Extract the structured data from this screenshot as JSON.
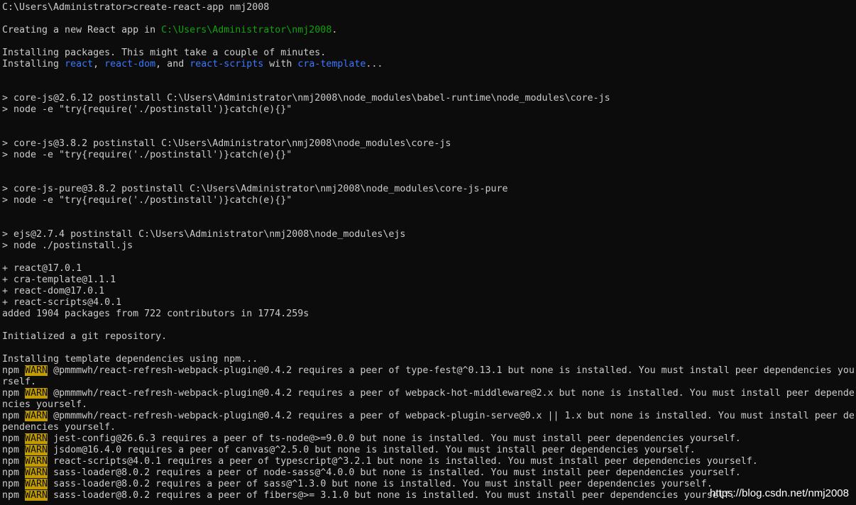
{
  "colors": {
    "background": "#0c0c0c",
    "text": "#cccccc",
    "green": "#13a10e",
    "blue": "#3b78ff",
    "warn_bg": "#c19c00"
  },
  "lines": [
    [
      {
        "t": "C:\\Users\\Administrator>create-react-app nmj2008"
      }
    ],
    [],
    [
      {
        "t": "Creating a new React app in "
      },
      {
        "t": "C:\\Users\\Administrator\\nmj2008",
        "c": "green"
      },
      {
        "t": "."
      }
    ],
    [],
    [
      {
        "t": "Installing packages. This might take a couple of minutes."
      }
    ],
    [
      {
        "t": "Installing "
      },
      {
        "t": "react",
        "c": "blue"
      },
      {
        "t": ", "
      },
      {
        "t": "react-dom",
        "c": "blue"
      },
      {
        "t": ", and "
      },
      {
        "t": "react-scripts",
        "c": "blue"
      },
      {
        "t": " with "
      },
      {
        "t": "cra-template",
        "c": "blue"
      },
      {
        "t": "..."
      }
    ],
    [],
    [],
    [
      {
        "t": "> core-js@2.6.12 postinstall C:\\Users\\Administrator\\nmj2008\\node_modules\\babel-runtime\\node_modules\\core-js"
      }
    ],
    [
      {
        "t": "> node -e \"try{require('./postinstall')}catch(e){}\""
      }
    ],
    [],
    [],
    [
      {
        "t": "> core-js@3.8.2 postinstall C:\\Users\\Administrator\\nmj2008\\node_modules\\core-js"
      }
    ],
    [
      {
        "t": "> node -e \"try{require('./postinstall')}catch(e){}\""
      }
    ],
    [],
    [],
    [
      {
        "t": "> core-js-pure@3.8.2 postinstall C:\\Users\\Administrator\\nmj2008\\node_modules\\core-js-pure"
      }
    ],
    [
      {
        "t": "> node -e \"try{require('./postinstall')}catch(e){}\""
      }
    ],
    [],
    [],
    [
      {
        "t": "> ejs@2.7.4 postinstall C:\\Users\\Administrator\\nmj2008\\node_modules\\ejs"
      }
    ],
    [
      {
        "t": "> node ./postinstall.js"
      }
    ],
    [],
    [
      {
        "t": "+ react@17.0.1"
      }
    ],
    [
      {
        "t": "+ cra-template@1.1.1"
      }
    ],
    [
      {
        "t": "+ react-dom@17.0.1"
      }
    ],
    [
      {
        "t": "+ react-scripts@4.0.1"
      }
    ],
    [
      {
        "t": "added 1904 packages from 722 contributors in 1774.259s"
      }
    ],
    [],
    [
      {
        "t": "Initialized a git repository."
      }
    ],
    [],
    [
      {
        "t": "Installing template dependencies using npm..."
      }
    ],
    [
      {
        "t": "npm "
      },
      {
        "t": "WARN",
        "c": "warn"
      },
      {
        "t": " @pmmmwh/react-refresh-webpack-plugin@0.4.2 requires a peer of type-fest@^0.13.1 but none is installed. You must install peer dependencies you"
      }
    ],
    [
      {
        "t": "rself."
      }
    ],
    [
      {
        "t": "npm "
      },
      {
        "t": "WARN",
        "c": "warn"
      },
      {
        "t": " @pmmmwh/react-refresh-webpack-plugin@0.4.2 requires a peer of webpack-hot-middleware@2.x but none is installed. You must install peer depende"
      }
    ],
    [
      {
        "t": "ncies yourself."
      }
    ],
    [
      {
        "t": "npm "
      },
      {
        "t": "WARN",
        "c": "warn"
      },
      {
        "t": " @pmmmwh/react-refresh-webpack-plugin@0.4.2 requires a peer of webpack-plugin-serve@0.x || 1.x but none is installed. You must install peer de"
      }
    ],
    [
      {
        "t": "pendencies yourself."
      }
    ],
    [
      {
        "t": "npm "
      },
      {
        "t": "WARN",
        "c": "warn"
      },
      {
        "t": " jest-config@26.6.3 requires a peer of ts-node@>=9.0.0 but none is installed. You must install peer dependencies yourself."
      }
    ],
    [
      {
        "t": "npm "
      },
      {
        "t": "WARN",
        "c": "warn"
      },
      {
        "t": " jsdom@16.4.0 requires a peer of canvas@^2.5.0 but none is installed. You must install peer dependencies yourself."
      }
    ],
    [
      {
        "t": "npm "
      },
      {
        "t": "WARN",
        "c": "warn"
      },
      {
        "t": " react-scripts@4.0.1 requires a peer of typescript@^3.2.1 but none is installed. You must install peer dependencies yourself."
      }
    ],
    [
      {
        "t": "npm "
      },
      {
        "t": "WARN",
        "c": "warn"
      },
      {
        "t": " sass-loader@8.0.2 requires a peer of node-sass@^4.0.0 but none is installed. You must install peer dependencies yourself."
      }
    ],
    [
      {
        "t": "npm "
      },
      {
        "t": "WARN",
        "c": "warn"
      },
      {
        "t": " sass-loader@8.0.2 requires a peer of sass@^1.3.0 but none is installed. You must install peer dependencies yourself."
      }
    ],
    [
      {
        "t": "npm "
      },
      {
        "t": "WARN",
        "c": "warn"
      },
      {
        "t": " sass-loader@8.0.2 requires a peer of fibers@>= 3.1.0 but none is installed. You must install peer dependencies yourself."
      }
    ]
  ],
  "watermark": "https://blog.csdn.net/nmj2008"
}
